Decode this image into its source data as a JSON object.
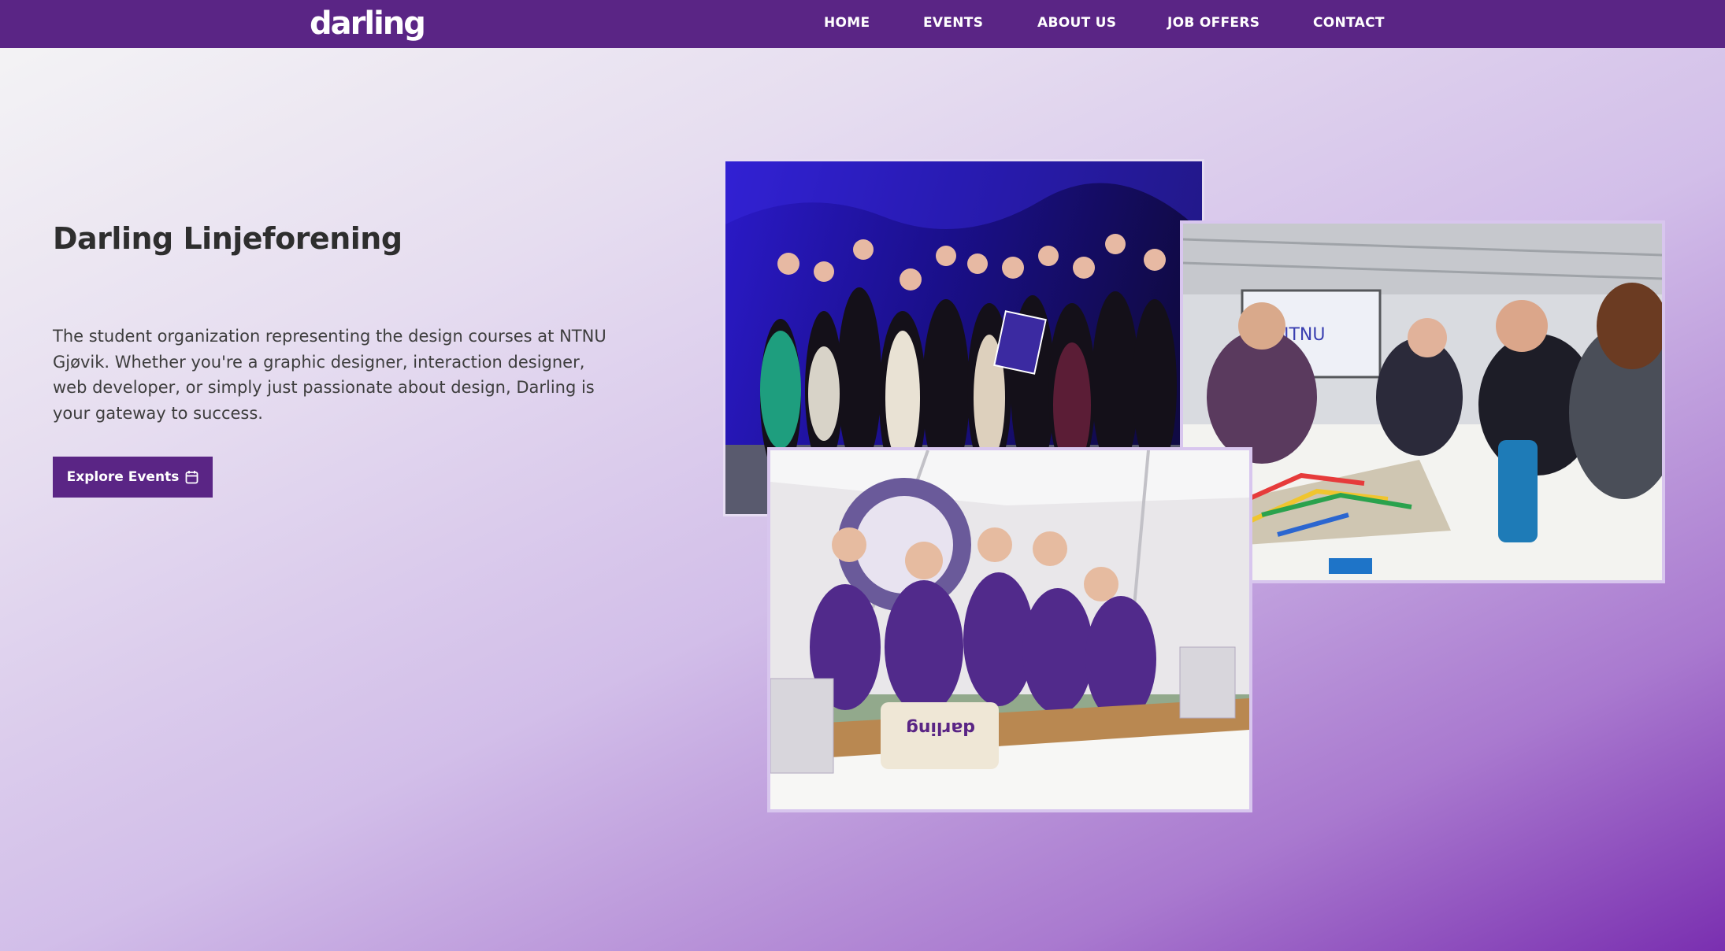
{
  "nav": {
    "logo": "darling",
    "items": [
      "HOME",
      "EVENTS",
      "ABOUT US",
      "JOB OFFERS",
      "CONTACT"
    ]
  },
  "hero": {
    "title": "Darling Linjeforening",
    "description": "The student organization representing the design courses at NTNU Gjøvik. Whether you're a graphic designer, interaction designer, web developer, or simply just passionate about design, Darling is your gateway to success.",
    "cta_label": "Explore Events",
    "cta_icon": "calendar-icon"
  },
  "photos": {
    "screen_text": "NTNU",
    "bag_text": "darling"
  },
  "colors": {
    "brand": "#5a2585",
    "text": "#2e2e2e"
  }
}
